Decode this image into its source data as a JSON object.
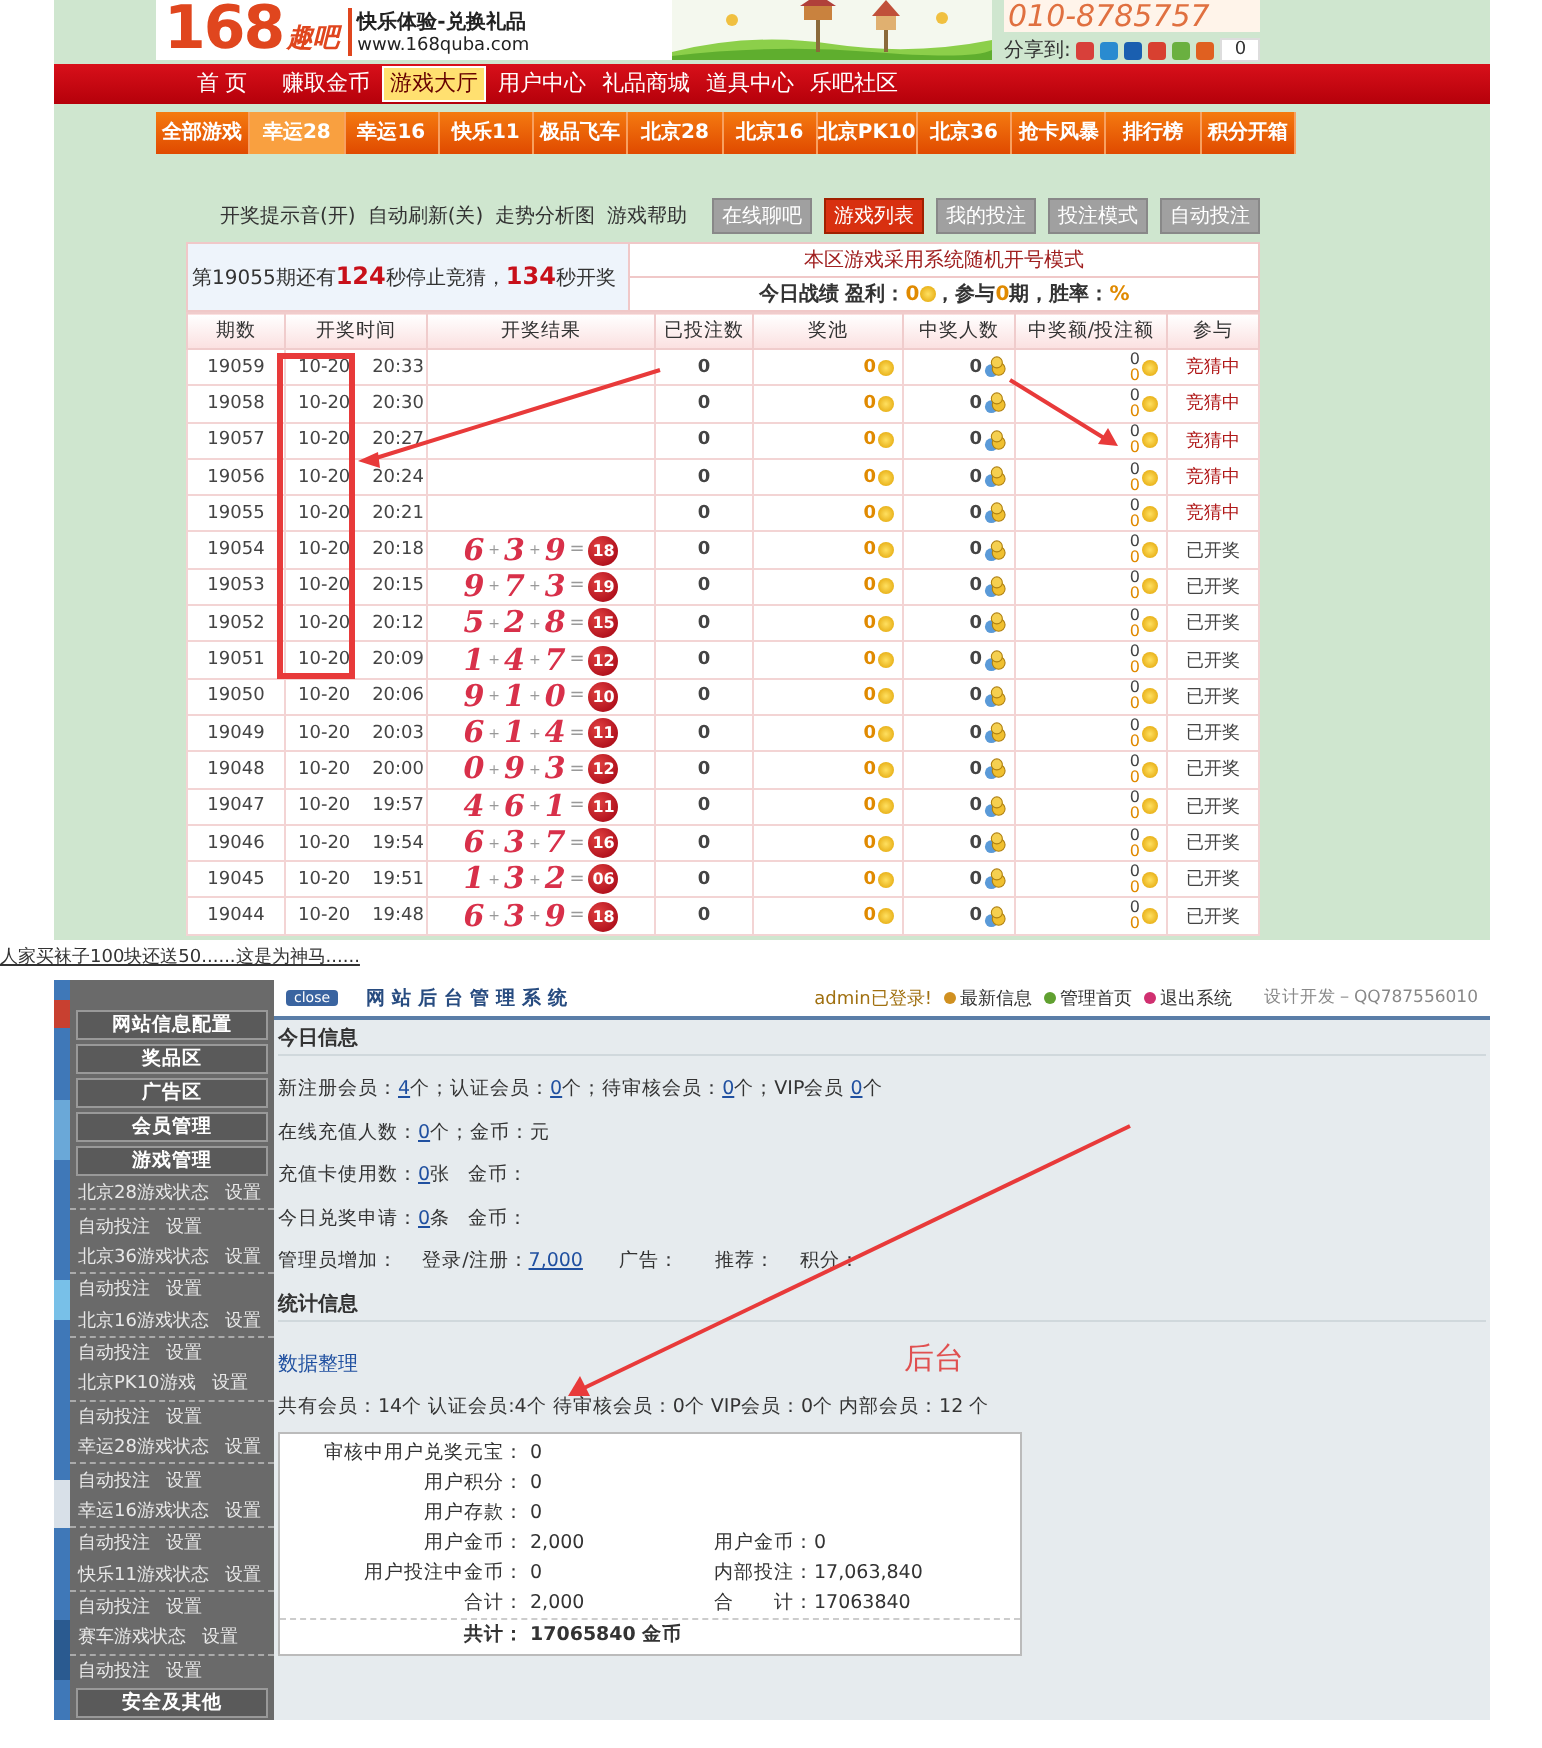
{
  "header": {
    "logo_number": "168",
    "logo_text": "趣吧",
    "slogan": "快乐体验-兑换礼品",
    "url": "www.168quba.com",
    "phone": "010-8785757",
    "share_label": "分享到:",
    "share_count": "0"
  },
  "main_nav": [
    {
      "label": "首 页",
      "selected": false
    },
    {
      "label": "赚取金币",
      "selected": false
    },
    {
      "label": "游戏大厅",
      "selected": true
    },
    {
      "label": "用户中心",
      "selected": false
    },
    {
      "label": "礼品商城",
      "selected": false
    },
    {
      "label": "道具中心",
      "selected": false
    },
    {
      "label": "乐吧社区",
      "selected": false
    }
  ],
  "game_nav": [
    {
      "label": "全部游戏",
      "selected": false
    },
    {
      "label": "幸运28",
      "selected": true
    },
    {
      "label": "幸运16",
      "selected": false
    },
    {
      "label": "快乐11",
      "selected": false
    },
    {
      "label": "极品飞车",
      "selected": false
    },
    {
      "label": "北京28",
      "selected": false
    },
    {
      "label": "北京16",
      "selected": false
    },
    {
      "label": "北京PK10",
      "selected": false
    },
    {
      "label": "北京36",
      "selected": false
    },
    {
      "label": "抢卡风暴",
      "selected": false
    },
    {
      "label": "排行榜",
      "selected": false
    },
    {
      "label": "积分开箱",
      "selected": false
    }
  ],
  "toolbar_links": [
    "开奖提示音(开)",
    "自动刷新(关)",
    "走势分析图",
    "游戏帮助"
  ],
  "toolbar_buttons": [
    {
      "label": "在线聊吧",
      "selected": false
    },
    {
      "label": "游戏列表",
      "selected": true
    },
    {
      "label": "我的投注",
      "selected": false
    },
    {
      "label": "投注模式",
      "selected": false
    },
    {
      "label": "自动投注",
      "selected": false
    }
  ],
  "countdown": {
    "before": "第19055期还有",
    "stop_seconds": "124",
    "middle": "秒停止竞猜，",
    "open_seconds": "134",
    "after": "秒开奖"
  },
  "notice": "本区游戏采用系统随机开号模式",
  "today": {
    "label": "今日战绩 盈利：",
    "profit": "0",
    "join_before": "，参与",
    "periods": "0",
    "join_after": "期，胜率：",
    "rate": "%"
  },
  "table": {
    "columns": [
      "期数",
      "开奖时间",
      "开奖结果",
      "已投注数",
      "奖池",
      "中奖人数",
      "中奖额/投注额",
      "参与"
    ],
    "plus": "+",
    "equals": "=",
    "rows": [
      {
        "period": "19059",
        "date": "10-20",
        "time": "20:33",
        "bets": "0",
        "pool": "0",
        "winners": "0",
        "win_amount": "0",
        "bet_amount": "0",
        "status": "竞猜中",
        "kind": "guessing"
      },
      {
        "period": "19058",
        "date": "10-20",
        "time": "20:30",
        "bets": "0",
        "pool": "0",
        "winners": "0",
        "win_amount": "0",
        "bet_amount": "0",
        "status": "竞猜中",
        "kind": "guessing"
      },
      {
        "period": "19057",
        "date": "10-20",
        "time": "20:27",
        "bets": "0",
        "pool": "0",
        "winners": "0",
        "win_amount": "0",
        "bet_amount": "0",
        "status": "竞猜中",
        "kind": "guessing"
      },
      {
        "period": "19056",
        "date": "10-20",
        "time": "20:24",
        "bets": "0",
        "pool": "0",
        "winners": "0",
        "win_amount": "0",
        "bet_amount": "0",
        "status": "竞猜中",
        "kind": "guessing"
      },
      {
        "period": "19055",
        "date": "10-20",
        "time": "20:21",
        "bets": "0",
        "pool": "0",
        "winners": "0",
        "win_amount": "0",
        "bet_amount": "0",
        "status": "竞猜中",
        "kind": "guessing"
      },
      {
        "period": "19054",
        "date": "10-20",
        "time": "20:18",
        "digits": [
          "6",
          "3",
          "9"
        ],
        "sum": "18",
        "bets": "0",
        "pool": "0",
        "winners": "0",
        "win_amount": "0",
        "bet_amount": "0",
        "status": "已开奖",
        "kind": "opened"
      },
      {
        "period": "19053",
        "date": "10-20",
        "time": "20:15",
        "digits": [
          "9",
          "7",
          "3"
        ],
        "sum": "19",
        "bets": "0",
        "pool": "0",
        "winners": "0",
        "win_amount": "0",
        "bet_amount": "0",
        "status": "已开奖",
        "kind": "opened"
      },
      {
        "period": "19052",
        "date": "10-20",
        "time": "20:12",
        "digits": [
          "5",
          "2",
          "8"
        ],
        "sum": "15",
        "bets": "0",
        "pool": "0",
        "winners": "0",
        "win_amount": "0",
        "bet_amount": "0",
        "status": "已开奖",
        "kind": "opened"
      },
      {
        "period": "19051",
        "date": "10-20",
        "time": "20:09",
        "digits": [
          "1",
          "4",
          "7"
        ],
        "sum": "12",
        "bets": "0",
        "pool": "0",
        "winners": "0",
        "win_amount": "0",
        "bet_amount": "0",
        "status": "已开奖",
        "kind": "opened"
      },
      {
        "period": "19050",
        "date": "10-20",
        "time": "20:06",
        "digits": [
          "9",
          "1",
          "0"
        ],
        "sum": "10",
        "bets": "0",
        "pool": "0",
        "winners": "0",
        "win_amount": "0",
        "bet_amount": "0",
        "status": "已开奖",
        "kind": "opened"
      },
      {
        "period": "19049",
        "date": "10-20",
        "time": "20:03",
        "digits": [
          "6",
          "1",
          "4"
        ],
        "sum": "11",
        "bets": "0",
        "pool": "0",
        "winners": "0",
        "win_amount": "0",
        "bet_amount": "0",
        "status": "已开奖",
        "kind": "opened"
      },
      {
        "period": "19048",
        "date": "10-20",
        "time": "20:00",
        "digits": [
          "0",
          "9",
          "3"
        ],
        "sum": "12",
        "bets": "0",
        "pool": "0",
        "winners": "0",
        "win_amount": "0",
        "bet_amount": "0",
        "status": "已开奖",
        "kind": "opened"
      },
      {
        "period": "19047",
        "date": "10-20",
        "time": "19:57",
        "digits": [
          "4",
          "6",
          "1"
        ],
        "sum": "11",
        "bets": "0",
        "pool": "0",
        "winners": "0",
        "win_amount": "0",
        "bet_amount": "0",
        "status": "已开奖",
        "kind": "opened"
      },
      {
        "period": "19046",
        "date": "10-20",
        "time": "19:54",
        "digits": [
          "6",
          "3",
          "7"
        ],
        "sum": "16",
        "bets": "0",
        "pool": "0",
        "winners": "0",
        "win_amount": "0",
        "bet_amount": "0",
        "status": "已开奖",
        "kind": "opened"
      },
      {
        "period": "19045",
        "date": "10-20",
        "time": "19:51",
        "digits": [
          "1",
          "3",
          "2"
        ],
        "sum": "06",
        "bets": "0",
        "pool": "0",
        "winners": "0",
        "win_amount": "0",
        "bet_amount": "0",
        "status": "已开奖",
        "kind": "opened"
      },
      {
        "period": "19044",
        "date": "10-20",
        "time": "19:48",
        "digits": [
          "6",
          "3",
          "9"
        ],
        "sum": "18",
        "bets": "0",
        "pool": "0",
        "winners": "0",
        "win_amount": "0",
        "bet_amount": "0",
        "status": "已开奖",
        "kind": "opened"
      }
    ]
  },
  "caption": "人家买袜子100块还送50......这是为神马......",
  "admin": {
    "close_label": "close",
    "title": "网站后台管理系统",
    "user": "admin已登录!",
    "links": [
      "最新信息",
      "管理首页",
      "退出系统"
    ],
    "credit": "设计开发－QQ787556010",
    "sidebar": [
      {
        "label": "网站信息配置",
        "kind": "section"
      },
      {
        "label": "奖品区",
        "kind": "section"
      },
      {
        "label": "广告区",
        "kind": "section"
      },
      {
        "label": "会员管理",
        "kind": "section"
      },
      {
        "label": "游戏管理",
        "kind": "section"
      },
      {
        "label": "北京28游戏状态",
        "action": "设置",
        "kind": "item"
      },
      {
        "label": "自动投注",
        "action": "设置",
        "kind": "item"
      },
      {
        "label": "北京36游戏状态",
        "action": "设置",
        "kind": "item"
      },
      {
        "label": "自动投注",
        "action": "设置",
        "kind": "item"
      },
      {
        "label": "北京16游戏状态",
        "action": "设置",
        "kind": "item"
      },
      {
        "label": "自动投注",
        "action": "设置",
        "kind": "item"
      },
      {
        "label": "北京PK10游戏",
        "action": "设置",
        "kind": "item"
      },
      {
        "label": "自动投注",
        "action": "设置",
        "kind": "item"
      },
      {
        "label": "幸运28游戏状态",
        "action": "设置",
        "kind": "item"
      },
      {
        "label": "自动投注",
        "action": "设置",
        "kind": "item"
      },
      {
        "label": "幸运16游戏状态",
        "action": "设置",
        "kind": "item"
      },
      {
        "label": "自动投注",
        "action": "设置",
        "kind": "item"
      },
      {
        "label": "快乐11游戏状态",
        "action": "设置",
        "kind": "item"
      },
      {
        "label": "自动投注",
        "action": "设置",
        "kind": "item"
      },
      {
        "label": "赛车游戏状态",
        "action": "设置",
        "kind": "item"
      },
      {
        "label": "自动投注",
        "action": "设置",
        "kind": "item"
      },
      {
        "label": "安全及其他",
        "kind": "section"
      }
    ],
    "today_title": "今日信息",
    "today_lines": [
      [
        "新注册会员：",
        {
          "link": "4"
        },
        "个；认证会员：",
        {
          "link": "0"
        },
        "个；待审核会员：",
        {
          "link": "0"
        },
        "个；VIP会员 ",
        {
          "link": "0"
        },
        "个"
      ],
      [
        "在线充值人数：",
        {
          "link": "0"
        },
        "个；金币：元"
      ],
      [
        "充值卡使用数：",
        {
          "link": "0"
        },
        "张   金币："
      ],
      [
        "今日兑奖申请：",
        {
          "link": "0"
        },
        "条   金币："
      ],
      [
        "管理员增加：    登录/注册：",
        {
          "link": "7,000"
        },
        "      广告：      推荐：    积分："
      ]
    ],
    "stats_title": "统计信息",
    "stats_link": "数据整理",
    "members": "共有会员：14个 认证会员:4个 待审核会员：0个 VIP会员：0个 内部会员：12 个",
    "stats_rows": [
      {
        "label": "审核中用户兑奖元宝：",
        "value": "0"
      },
      {
        "label": "用户积分：",
        "value": "0"
      },
      {
        "label": "用户存款：",
        "value": "0"
      },
      {
        "label": "用户金币：",
        "value": "2,000",
        "label2": "用户金币：",
        "value2": "0"
      },
      {
        "label": "用户投注中金币：",
        "value": "0",
        "label2": "内部投注：",
        "value2": "17,063,840"
      },
      {
        "label": "合计：",
        "value": "2,000",
        "label2": "合　　计：",
        "value2": "17063840"
      }
    ],
    "total": {
      "label": "共计：",
      "value": "17065840 金币"
    },
    "annotation_label": "后台"
  }
}
